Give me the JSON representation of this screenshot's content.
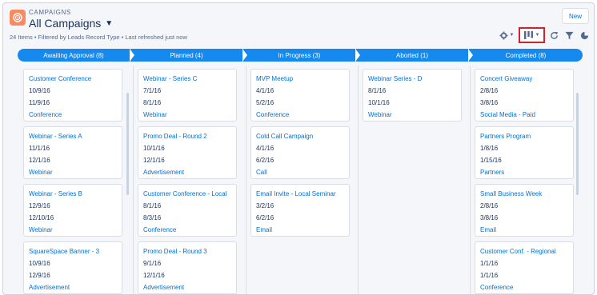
{
  "header": {
    "object_label": "CAMPAIGNS",
    "list_title": "All Campaigns",
    "meta": "24 Items • Filtered by Leads Record Type • Last refreshed just now",
    "new_button": "New"
  },
  "colors": {
    "accent": "#1589ee",
    "brand_icon": "#f88962",
    "highlight": "#d0232b"
  },
  "stages": [
    {
      "label": "Awaiting Approval (8)"
    },
    {
      "label": "Planned (4)"
    },
    {
      "label": "In Progress (3)"
    },
    {
      "label": "Aborted (1)"
    },
    {
      "label": "Completed (8)"
    }
  ],
  "columns": [
    {
      "cards": [
        {
          "title": "Customer Conference",
          "start": "10/9/16",
          "end": "11/9/16",
          "type": "Conference"
        },
        {
          "title": "Webinar - Series A",
          "start": "11/1/16",
          "end": "12/1/16",
          "type": "Webinar"
        },
        {
          "title": "Webinar - Series B",
          "start": "12/9/16",
          "end": "12/10/16",
          "type": "Webinar"
        },
        {
          "title": "SquareSpace Banner - 3",
          "start": "10/9/16",
          "end": "12/9/16",
          "type": "Advertisement"
        }
      ]
    },
    {
      "cards": [
        {
          "title": "Webinar - Series C",
          "start": "7/1/16",
          "end": "8/1/16",
          "type": "Webinar"
        },
        {
          "title": "Promo Deal - Round 2",
          "start": "10/1/16",
          "end": "12/1/16",
          "type": "Advertisement"
        },
        {
          "title": "Customer Conference - Local",
          "start": "8/1/16",
          "end": "8/3/16",
          "type": "Conference"
        },
        {
          "title": "Promo Deal - Round 3",
          "start": "9/1/16",
          "end": "12/1/16",
          "type": "Advertisement"
        }
      ]
    },
    {
      "cards": [
        {
          "title": "MVP Meetup",
          "start": "4/1/16",
          "end": "5/2/16",
          "type": "Conference"
        },
        {
          "title": "Cold Call Campaign",
          "start": "4/1/16",
          "end": "6/2/16",
          "type": "Call"
        },
        {
          "title": "Email Invite - Local Seminar",
          "start": "3/2/16",
          "end": "6/2/16",
          "type": "Email"
        }
      ]
    },
    {
      "cards": [
        {
          "title": "Webinar Series - D",
          "start": "8/1/16",
          "end": "10/1/16",
          "type": "Webinar"
        }
      ]
    },
    {
      "cards": [
        {
          "title": "Concert Giveaway",
          "start": "2/8/16",
          "end": "3/8/16",
          "type": "Social Media - Paid"
        },
        {
          "title": "Partners Program",
          "start": "1/8/16",
          "end": "1/15/16",
          "type": "Partners"
        },
        {
          "title": "Small Business Week",
          "start": "2/8/16",
          "end": "3/8/16",
          "type": "Email"
        },
        {
          "title": "Customer Conf. - Regional",
          "start": "1/1/16",
          "end": "1/1/16",
          "type": "Conference"
        }
      ]
    }
  ]
}
